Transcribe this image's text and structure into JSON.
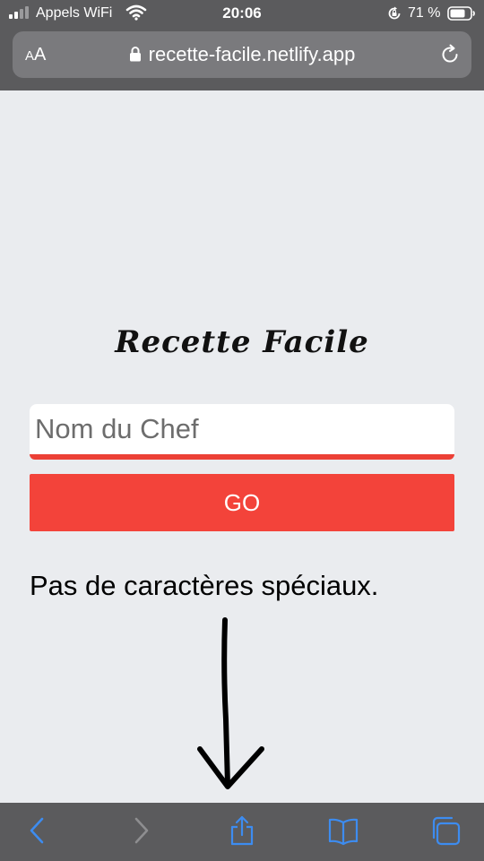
{
  "status_bar": {
    "carrier": "Appels WiFi",
    "time": "20:06",
    "battery_percent": "71 %",
    "icons": [
      "signal-icon",
      "wifi-icon",
      "rotation-lock-icon",
      "battery-icon"
    ]
  },
  "browser": {
    "text_size_label_small": "A",
    "text_size_label_large": "A",
    "url": "recette-facile.netlify.app",
    "icons": [
      "lock-icon",
      "reload-icon"
    ],
    "toolbar_icons": [
      "back-icon",
      "forward-icon",
      "share-icon",
      "bookmarks-icon",
      "tabs-icon"
    ]
  },
  "page": {
    "title": "Recette Facile",
    "name_input": {
      "value": "",
      "placeholder": "Nom du Chef"
    },
    "go_button_label": "GO",
    "hint": "Pas de caractères spéciaux."
  },
  "colors": {
    "accent": "#f3433a",
    "chrome": "#5b5b5d",
    "page_background": "#eaecef",
    "ios_blue": "#3d8cf0"
  }
}
